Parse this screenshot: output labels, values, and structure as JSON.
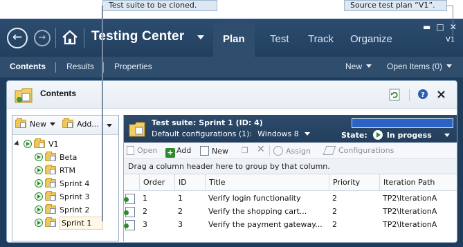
{
  "callouts": {
    "left": "Test suite to be cloned.",
    "right": "Source test plan “V1”."
  },
  "app": {
    "title": "Testing Center",
    "nav_tabs": [
      "Plan",
      "Test",
      "Track",
      "Organize"
    ],
    "active_tab": "Plan",
    "plan_version": "V1",
    "window_controls": [
      "minimize",
      "maximize",
      "close"
    ]
  },
  "subnav": {
    "items": [
      "Contents",
      "Results",
      "Properties"
    ],
    "active": "Contents",
    "right_new": "New",
    "right_open_items": "Open Items (0)"
  },
  "pane": {
    "title": "Contents",
    "tools": [
      "refresh-icon",
      "help-icon",
      "close-icon"
    ]
  },
  "tree": {
    "toolbar_new": "New",
    "toolbar_add": "Add...",
    "root": "V1",
    "children": [
      "Beta",
      "RTM",
      "Sprint 4",
      "Sprint 3",
      "Sprint 2",
      "Sprint 1"
    ],
    "selected": "Sprint 1"
  },
  "suite": {
    "title": "Test suite:  Sprint 1 (ID: 4)",
    "config_label": "Default configurations (1):",
    "config_value": "Windows 8",
    "state_label": "State:",
    "state_value": "In progess",
    "progress": 1.0,
    "colors": {
      "progress_fill": "#2b62c8",
      "header_bg": "#2d4b6d"
    }
  },
  "suite_toolbar": {
    "open": "Open",
    "add": "Add",
    "new": "New",
    "assign": "Assign",
    "configurations": "Configurations"
  },
  "grid": {
    "group_hint": "Drag a column header here to group by that column.",
    "columns": [
      "Order",
      "ID",
      "Title",
      "Priority",
      "Iteration Path"
    ],
    "rows": [
      {
        "order": "1",
        "id": "1",
        "title": "Verify login functionality",
        "priority": "2",
        "iteration": "TP2\\IterationA"
      },
      {
        "order": "2",
        "id": "2",
        "title": "Verify the shopping cart...",
        "priority": "2",
        "iteration": "TP2\\IterationA"
      },
      {
        "order": "3",
        "id": "3",
        "title": "Verify the payment gateway...",
        "priority": "2",
        "iteration": "TP2\\IterationA"
      }
    ]
  }
}
